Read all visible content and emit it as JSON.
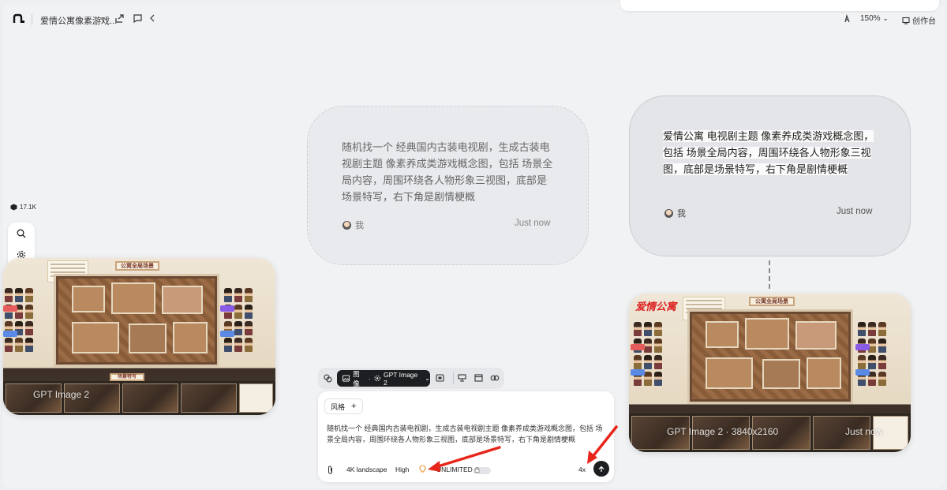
{
  "topbar": {
    "project_title": "爱情公寓像素游戏...",
    "zoom": "150%",
    "create_label": "创作台"
  },
  "sidebar": {
    "stat_value": "17.1K"
  },
  "left_card": {
    "overlay_label": "GPT Image 2"
  },
  "right_card": {
    "overlay_label": "GPT Image 2 · 3840x2160",
    "time": "Just now",
    "banner_title": "公寓全局场景",
    "logo_text": "爱情公寓"
  },
  "left_card_art": {
    "banner_title": "公寓全局场景",
    "bottom_title": "场景特写"
  },
  "bubble_left": {
    "text": "随机找一个 经典国内古装电视剧，生成古装电视剧主题 像素养成类游戏概念图，包括 场景全局内容，周围环绕各人物形象三视图，底部是场景特写，右下角是剧情梗概",
    "user": "我",
    "time": "Just now",
    "text_color": "#666666"
  },
  "bubble_right": {
    "text": "爱情公寓 电视剧主题 像素养成类游戏概念图，包括 场景全局内容，周围环绕各人物形象三视图，底部是场景特写，右下角是剧情梗概",
    "user": "我",
    "time": "Just now",
    "text_color": "#222222"
  },
  "composer_toolbar": {
    "mode_label": "图像",
    "model_label": "GPT Image 2"
  },
  "composer": {
    "style_label": "风格",
    "prompt": "随机找一个 经典国内古装电视剧，生成古装电视剧主题 像素养成类游戏概念图，包括 场景全局内容，周围环绕各人物形象三视图，底部是场景特写，右下角是剧情梗概",
    "aspect_label": "4K landscape",
    "quality_label": "High",
    "unlimited_label": "UNLIMITED",
    "count_label": "4x"
  },
  "colors": {
    "accent_dark": "#1d1e21",
    "arrow_red": "#e8251b",
    "bulb_orange": "#e8962e"
  },
  "icons": [
    "logo-icon",
    "share-icon",
    "comment-icon",
    "collapse-icon",
    "theme-icon",
    "chevron-down-icon",
    "monitor-icon",
    "cube-icon",
    "search-icon",
    "gear-icon",
    "note-icon",
    "layers-icon",
    "image-icon",
    "screen-icon",
    "frame-icon",
    "link-icon",
    "attach-icon",
    "bulb-icon",
    "lock-icon",
    "arrow-up-icon",
    "plus-icon"
  ]
}
